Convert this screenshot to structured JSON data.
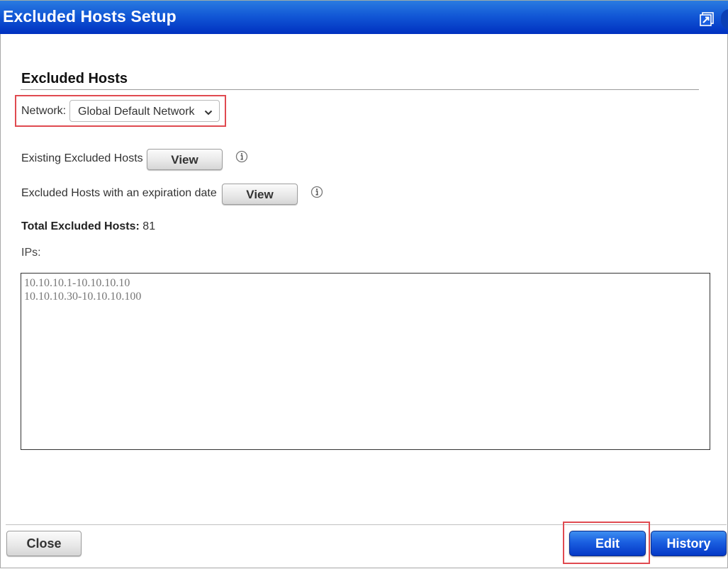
{
  "window": {
    "title": "Excluded Hosts Setup",
    "popout_icon": "popout-window-icon"
  },
  "section": {
    "title": "Excluded Hosts"
  },
  "network": {
    "label": "Network:",
    "selected": "Global Default Network",
    "icon": "chevron-down-icon"
  },
  "existing": {
    "label": "Existing Excluded Hosts",
    "button": "View",
    "info_icon": "info-icon"
  },
  "expiring": {
    "label": "Excluded Hosts with an expiration date",
    "button": "View",
    "info_icon": "info-icon"
  },
  "total": {
    "label": "Total Excluded Hosts:",
    "value": "81"
  },
  "ips": {
    "label": "IPs:",
    "value": "10.10.10.1-10.10.10.10\n10.10.10.30-10.10.10.100"
  },
  "footer": {
    "close": "Close",
    "edit": "Edit",
    "history": "History"
  },
  "colors": {
    "titlebar": "#1258d6",
    "primary_button": "#1a5ee0",
    "highlight": "#e04a50"
  }
}
